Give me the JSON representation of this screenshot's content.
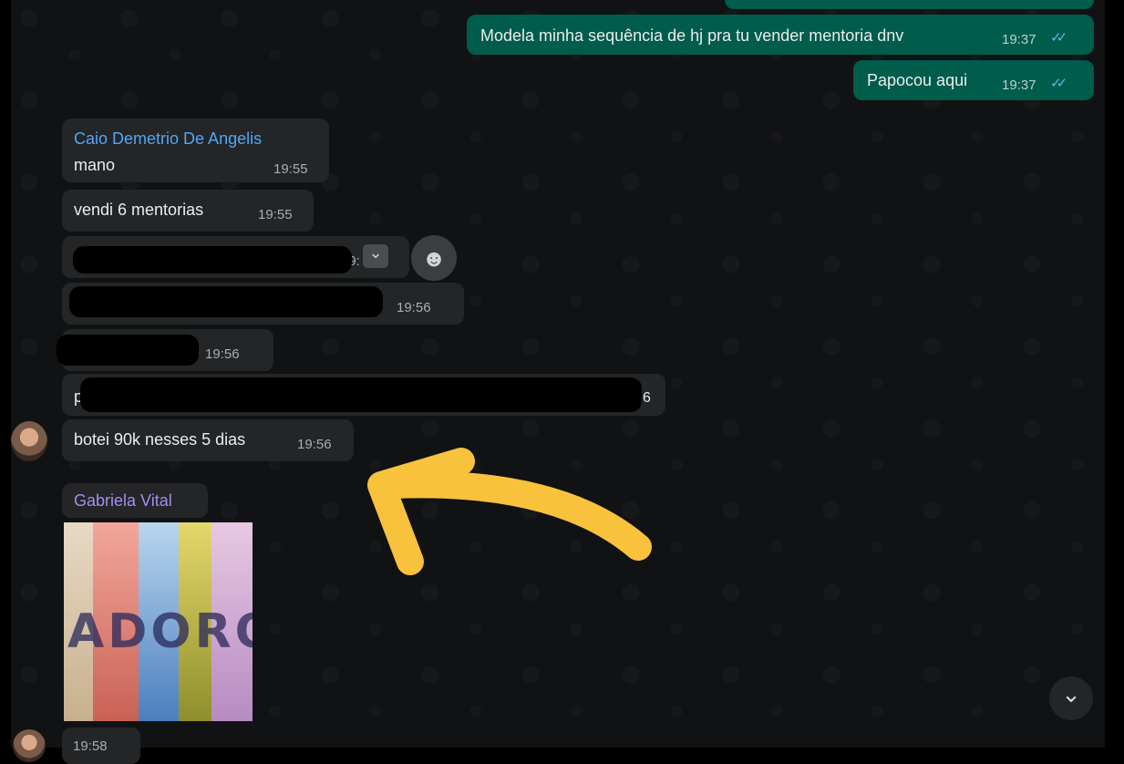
{
  "messages": {
    "out1": {
      "text": "Modela minha sequência de hj pra tu vender mentoria dnv",
      "time": "19:37"
    },
    "out2": {
      "text": "Papocou aqui",
      "time": "19:37"
    },
    "in1": {
      "sender": "Caio Demetrio De Angelis",
      "text": "mano",
      "time": "19:55"
    },
    "in2": {
      "text": "vendi 6 mentorias",
      "time": "19:55"
    },
    "in3": {
      "time_partial": "19:"
    },
    "in4": {
      "time": "19:56"
    },
    "in5": {
      "time": "19:56"
    },
    "in6": {
      "text_start": "p",
      "text_end": "6"
    },
    "in7": {
      "text": "botei 90k nesses 5 dias",
      "time": "19:56"
    },
    "in8": {
      "sender": "Gabriela Vital",
      "sticker_text": "ADORO",
      "time": "19:58"
    }
  },
  "icons": {
    "read_ticks": "✓✓",
    "chevron": "⌄",
    "emoji": "☻"
  },
  "colors": {
    "outgoing_bubble": "#005c4b",
    "incoming_bubble": "#232526",
    "caio_name": "#53a6f5",
    "gabriela_name": "#a98bf0",
    "arrow": "#f8c23c"
  }
}
